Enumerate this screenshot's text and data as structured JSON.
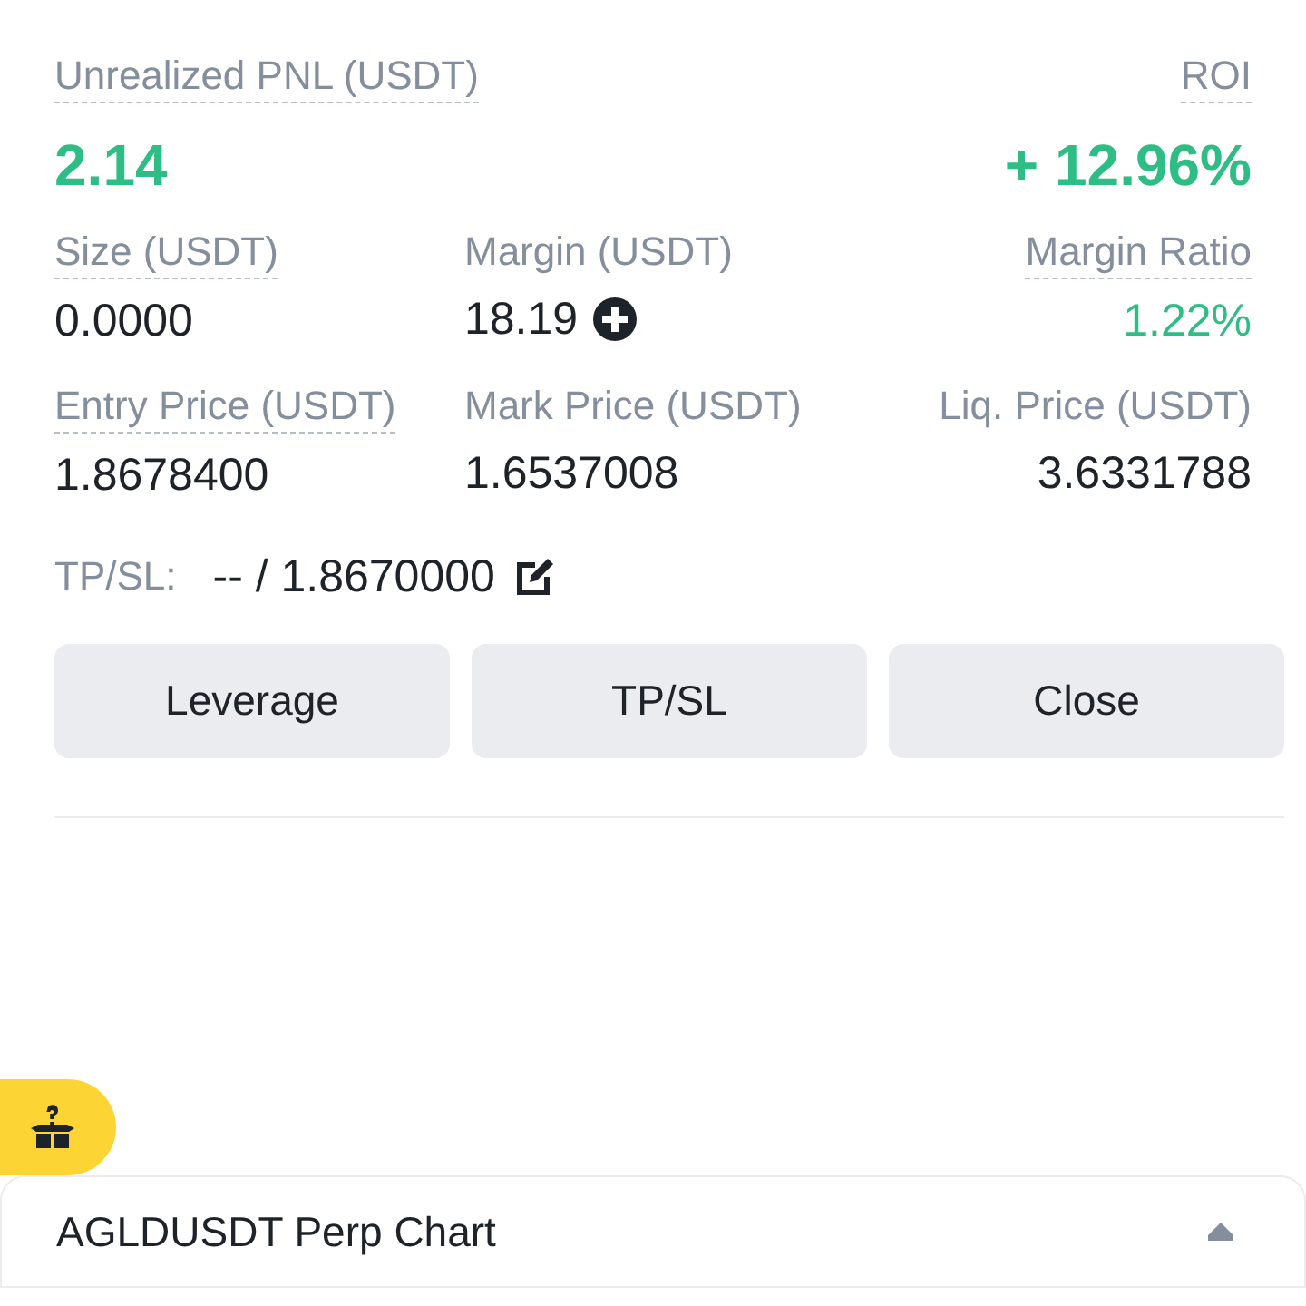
{
  "summary": [
    {
      "label": "Unrealized PNL (USDT)",
      "underlined": true,
      "value": "2.14",
      "positive": true
    },
    {
      "label": "ROI",
      "underlined": true,
      "value": "+ 12.96%",
      "positive": true
    }
  ],
  "fields": [
    {
      "label": "Size (USDT)",
      "underlined": true,
      "value": "0.0000",
      "positive": false,
      "add_button": false
    },
    {
      "label": "Margin (USDT)",
      "underlined": false,
      "value": "18.19",
      "positive": false,
      "add_button": true
    },
    {
      "label": "Margin Ratio",
      "underlined": true,
      "value": "1.22%",
      "positive": true,
      "add_button": false
    },
    {
      "label": "Entry Price (USDT)",
      "underlined": true,
      "value": "1.8678400",
      "positive": false,
      "add_button": false
    },
    {
      "label": "Mark Price (USDT)",
      "underlined": false,
      "value": "1.6537008",
      "positive": false,
      "add_button": false
    },
    {
      "label": "Liq. Price (USDT)",
      "underlined": false,
      "value": "3.6331788",
      "positive": false,
      "add_button": false
    }
  ],
  "tpsl": {
    "label": "TP/SL:",
    "value": "-- / 1.8670000"
  },
  "buttons": [
    "Leverage",
    "TP/SL",
    "Close"
  ],
  "chart_bar": {
    "title": "AGLDUSDT Perp Chart",
    "expanded": false
  }
}
